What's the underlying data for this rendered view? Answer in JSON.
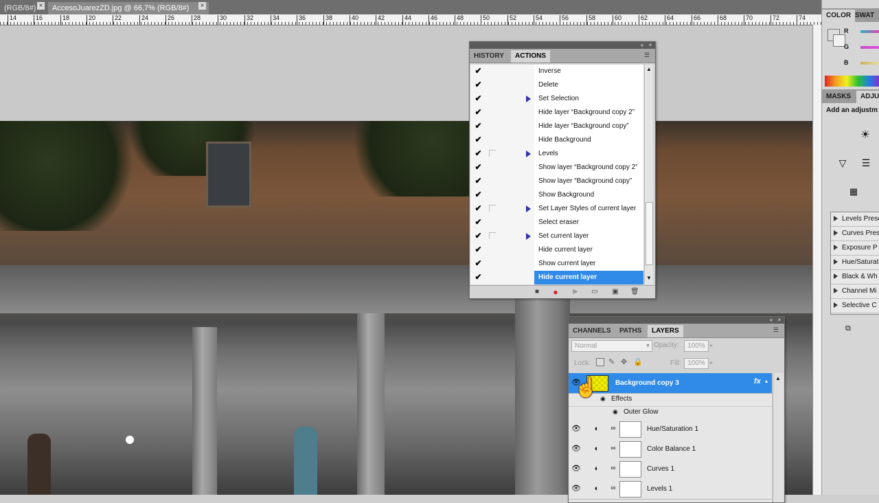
{
  "doc_tabs": [
    {
      "label": "(RGB/8#)",
      "active": false
    },
    {
      "label": "AccesoJuarezZD.jpg @ 66,7% (RGB/8#)",
      "active": true
    }
  ],
  "ruler_numbers": [
    "14",
    "16",
    "18",
    "20",
    "22",
    "24",
    "26",
    "28",
    "30",
    "32",
    "34",
    "36",
    "38",
    "40",
    "42",
    "44",
    "46",
    "48",
    "50",
    "52",
    "54",
    "56",
    "58",
    "60",
    "62",
    "64",
    "66",
    "68",
    "70",
    "72",
    "74"
  ],
  "right_dock": {
    "color_tabs": [
      "COLOR",
      "SWAT"
    ],
    "channels": [
      "R",
      "G",
      "B"
    ],
    "masks_tabs": [
      "MASKS",
      "ADJU"
    ],
    "add_adjust_label": "Add an adjustm",
    "presets": [
      "Levels Prese",
      "Curves Pres",
      "Exposure P",
      "Hue/Saturat",
      "Black & Wh",
      "Channel Mi",
      "Selective C"
    ]
  },
  "actions_panel": {
    "tabs": [
      "HISTORY",
      "ACTIONS"
    ],
    "active_tab": "ACTIONS",
    "items": [
      {
        "label": "Inverse",
        "checked": true,
        "dialog": false,
        "expandable": false,
        "selected": false
      },
      {
        "label": "Delete",
        "checked": true,
        "dialog": false,
        "expandable": false,
        "selected": false
      },
      {
        "label": "Set Selection",
        "checked": true,
        "dialog": false,
        "expandable": true,
        "selected": false
      },
      {
        "label": "Hide layer “Background copy 2”",
        "checked": true,
        "dialog": false,
        "expandable": false,
        "selected": false
      },
      {
        "label": "Hide layer “Background copy”",
        "checked": true,
        "dialog": false,
        "expandable": false,
        "selected": false
      },
      {
        "label": "Hide Background",
        "checked": true,
        "dialog": false,
        "expandable": false,
        "selected": false
      },
      {
        "label": "Levels",
        "checked": true,
        "dialog": true,
        "expandable": true,
        "selected": false
      },
      {
        "label": "Show layer “Background copy 2”",
        "checked": true,
        "dialog": false,
        "expandable": false,
        "selected": false
      },
      {
        "label": "Show layer “Background copy”",
        "checked": true,
        "dialog": false,
        "expandable": false,
        "selected": false
      },
      {
        "label": "Show Background",
        "checked": true,
        "dialog": false,
        "expandable": false,
        "selected": false
      },
      {
        "label": "Set Layer Styles of current layer",
        "checked": true,
        "dialog": true,
        "expandable": true,
        "selected": false
      },
      {
        "label": "Select eraser",
        "checked": true,
        "dialog": false,
        "expandable": false,
        "selected": false
      },
      {
        "label": "Set current layer",
        "checked": true,
        "dialog": true,
        "expandable": true,
        "selected": false
      },
      {
        "label": "Hide current layer",
        "checked": true,
        "dialog": false,
        "expandable": false,
        "selected": false
      },
      {
        "label": "Show current layer",
        "checked": true,
        "dialog": false,
        "expandable": false,
        "selected": false
      },
      {
        "label": "Hide current layer",
        "checked": true,
        "dialog": false,
        "expandable": false,
        "selected": true
      }
    ]
  },
  "layers_panel": {
    "tabs": [
      "CHANNELS",
      "PATHS",
      "LAYERS"
    ],
    "active_tab": "LAYERS",
    "blend_mode": "Normal",
    "opacity_label": "Opacity:",
    "opacity_value": "100%",
    "lock_label": "Lock:",
    "fill_label": "Fill:",
    "fill_value": "100%",
    "effects_label": "Effects",
    "outer_glow_label": "Outer Glow",
    "fx_label": "fx",
    "layers": [
      {
        "name": "Background copy 3",
        "selected": true
      },
      {
        "name": "Hue/Saturation 1",
        "selected": false
      },
      {
        "name": "Color Balance 1",
        "selected": false
      },
      {
        "name": "Curves 1",
        "selected": false
      },
      {
        "name": "Levels 1",
        "selected": false
      }
    ]
  }
}
